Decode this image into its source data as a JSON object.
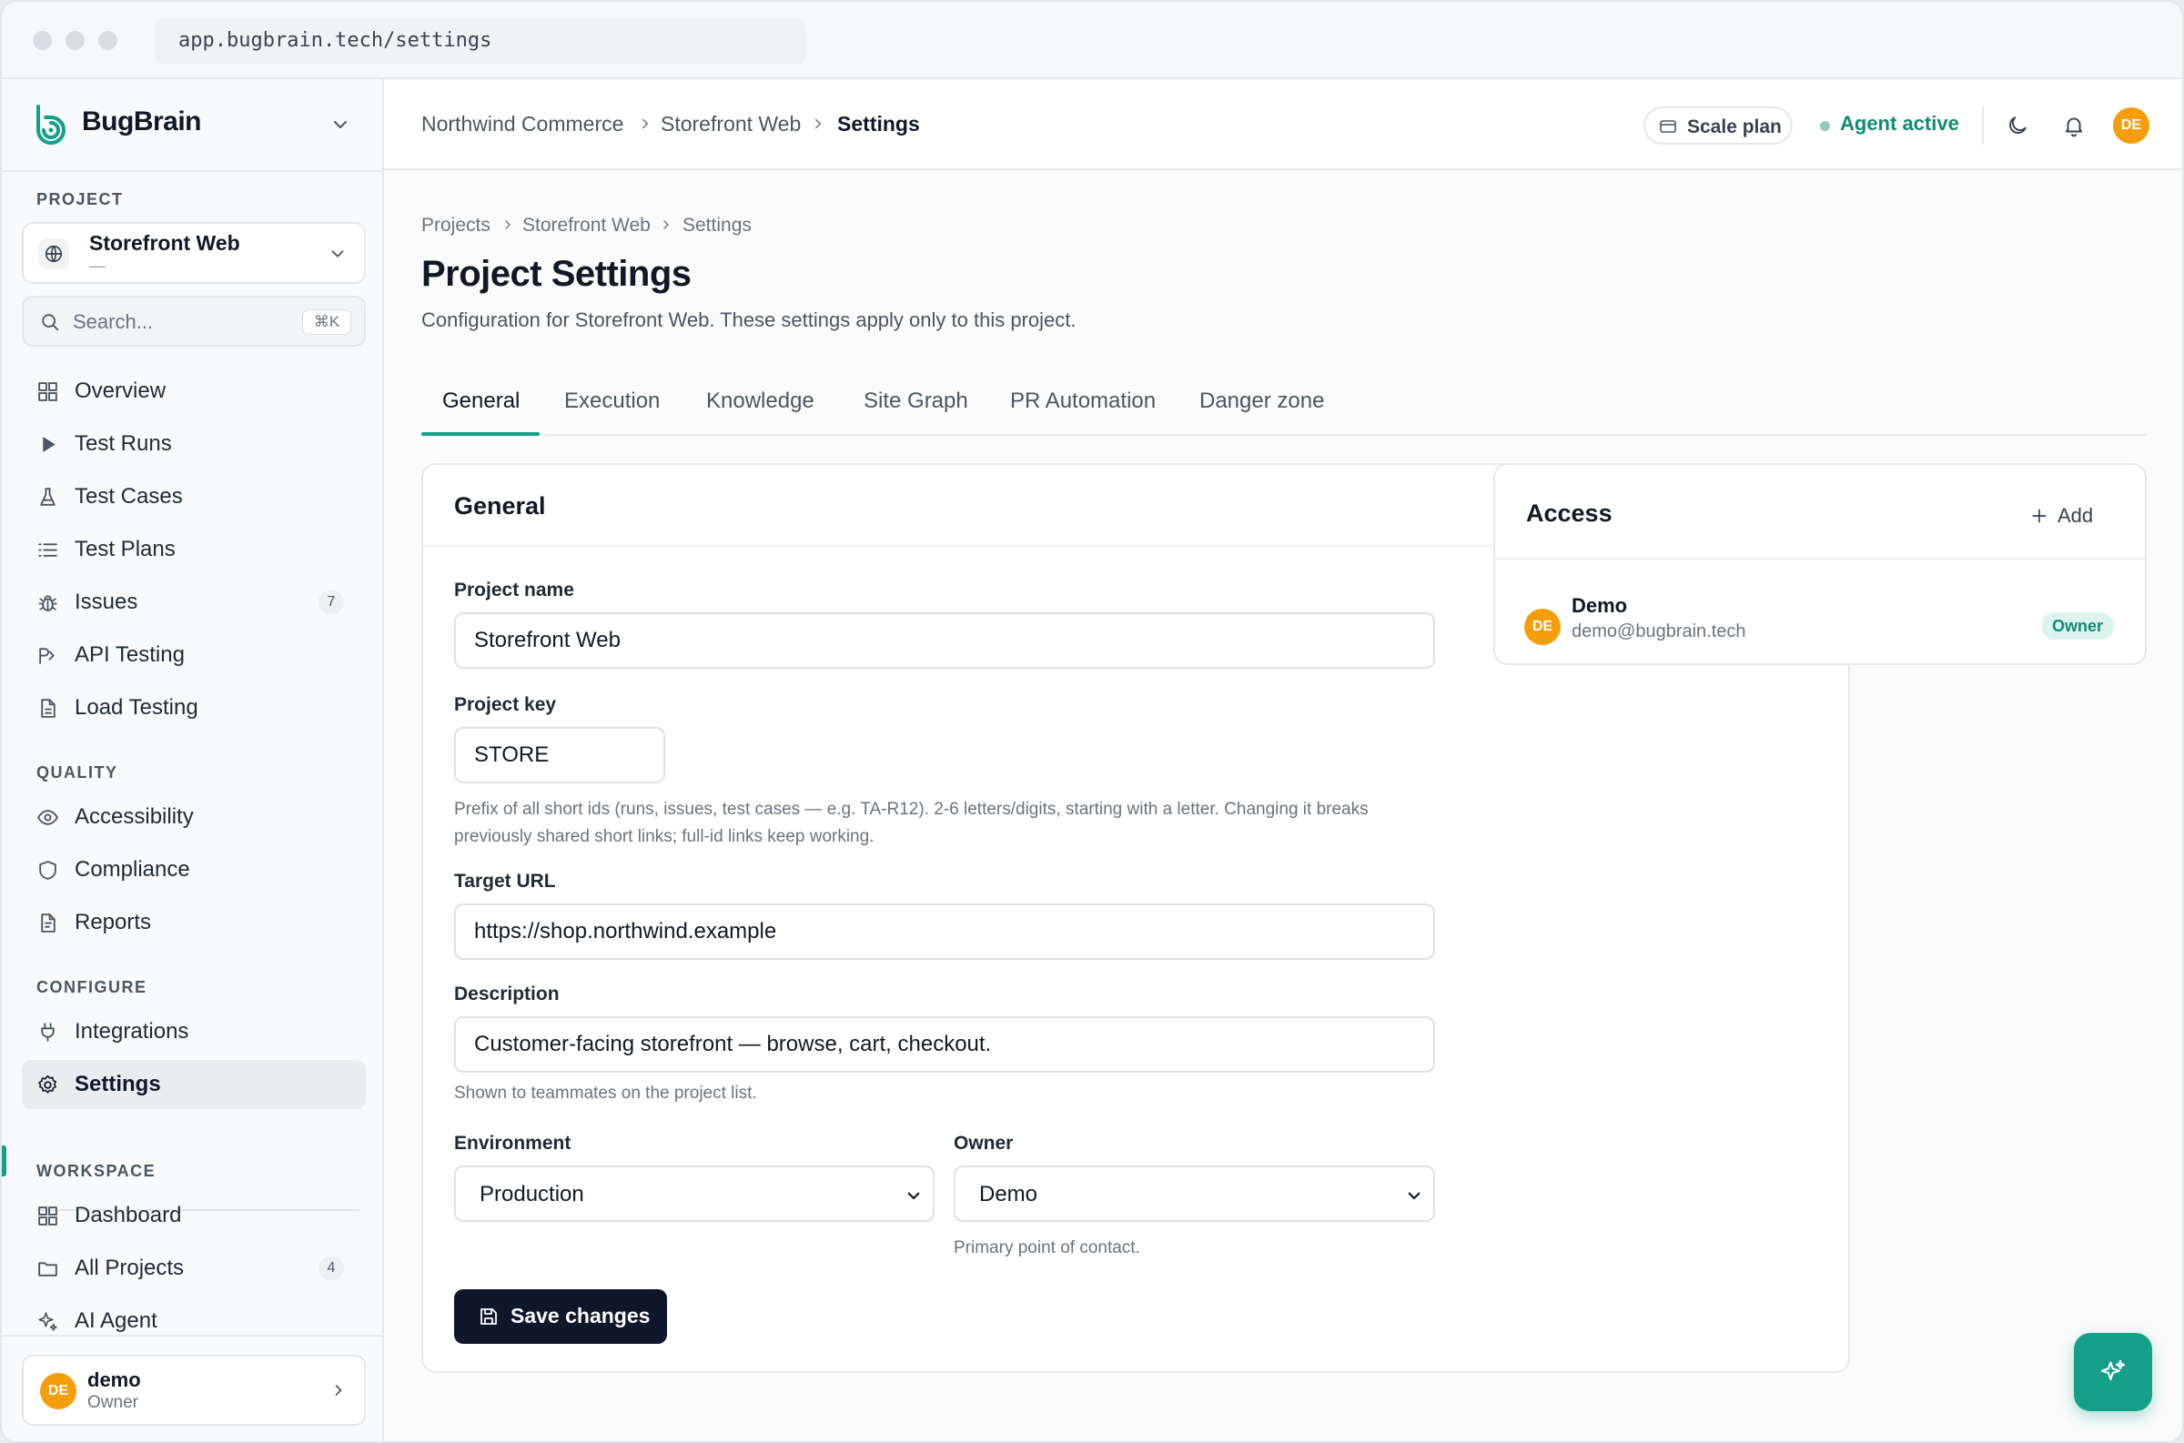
{
  "browser": {
    "url": "app.bugbrain.tech/settings"
  },
  "brand": {
    "name": "BugBrain"
  },
  "sidebar": {
    "project_label": "PROJECT",
    "project_select": {
      "name": "Storefront Web",
      "sub": "—"
    },
    "search": {
      "placeholder": "Search...",
      "shortcut": "⌘K"
    },
    "main_items": [
      {
        "label": "Overview",
        "icon": "grid-icon"
      },
      {
        "label": "Test Runs",
        "icon": "play-icon"
      },
      {
        "label": "Test Cases",
        "icon": "flask-icon"
      },
      {
        "label": "Test Plans",
        "icon": "list-icon"
      },
      {
        "label": "Issues",
        "icon": "bug-icon",
        "badge": "7"
      },
      {
        "label": "API Testing",
        "icon": "api-icon"
      },
      {
        "label": "Load Testing",
        "icon": "file-icon"
      }
    ],
    "quality_label": "QUALITY",
    "quality_items": [
      {
        "label": "Accessibility",
        "icon": "eye-icon"
      },
      {
        "label": "Compliance",
        "icon": "shield-icon"
      },
      {
        "label": "Reports",
        "icon": "report-icon"
      }
    ],
    "configure_label": "CONFIGURE",
    "configure_items": [
      {
        "label": "Integrations",
        "icon": "plug-icon"
      },
      {
        "label": "Settings",
        "icon": "gear-icon",
        "active": true
      }
    ],
    "workspace_label": "WORKSPACE",
    "workspace_items": [
      {
        "label": "Dashboard",
        "icon": "grid-icon"
      },
      {
        "label": "All Projects",
        "icon": "folder-icon",
        "badge": "4"
      },
      {
        "label": "AI Agent",
        "icon": "sparkle-icon"
      }
    ],
    "user": {
      "initials": "DE",
      "name": "demo",
      "role": "Owner"
    }
  },
  "header": {
    "breadcrumb": [
      "Northwind Commerce",
      "Storefront Web",
      "Settings"
    ],
    "plan": "Scale plan",
    "agent_status": "Agent active",
    "avatar_initials": "DE"
  },
  "main": {
    "breadcrumb": [
      "Projects",
      "Storefront Web",
      "Settings"
    ],
    "title": "Project Settings",
    "subtitle": "Configuration for Storefront Web. These settings apply only to this project.",
    "tabs": [
      "General",
      "Execution",
      "Knowledge",
      "Site Graph",
      "PR Automation",
      "Danger zone"
    ],
    "general": {
      "title": "General",
      "project_name_label": "Project name",
      "project_name": "Storefront Web",
      "project_key_label": "Project key",
      "project_key": "STORE",
      "project_key_hint_1": "Prefix of all short ids (runs, issues, test cases — e.g. TA-R12). 2-6 letters/digits, starting with a letter. Changing it breaks",
      "project_key_hint_2": "previously shared short links; full-id links keep working.",
      "target_url_label": "Target URL",
      "target_url": "https://shop.northwind.example",
      "description_label": "Description",
      "description": "Customer-facing storefront — browse, cart, checkout.",
      "description_hint": "Shown to teammates on the project list.",
      "environment_label": "Environment",
      "environment": "Production",
      "owner_label": "Owner",
      "owner": "Demo",
      "owner_hint": "Primary point of contact.",
      "save_label": "Save changes"
    },
    "access": {
      "title": "Access",
      "add_label": "Add",
      "member": {
        "initials": "DE",
        "name": "Demo",
        "email": "demo@bugbrain.tech",
        "role": "Owner"
      }
    }
  },
  "colors": {
    "accent": "#14a088",
    "avatar": "#f59e0b",
    "primary_button": "#0f172a"
  }
}
